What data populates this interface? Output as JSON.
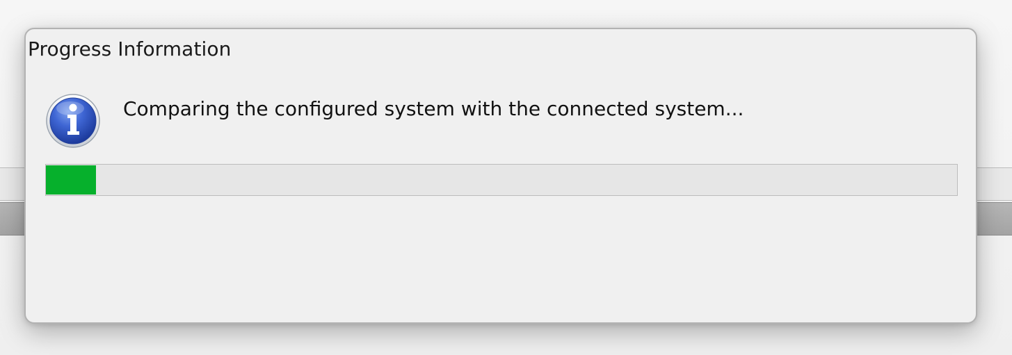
{
  "dialog": {
    "title": "Progress Information",
    "message": "Comparing the configured system with the connected system...",
    "icon": "info-icon",
    "progress": {
      "fraction": 0.055,
      "color": "#06b02c"
    }
  }
}
